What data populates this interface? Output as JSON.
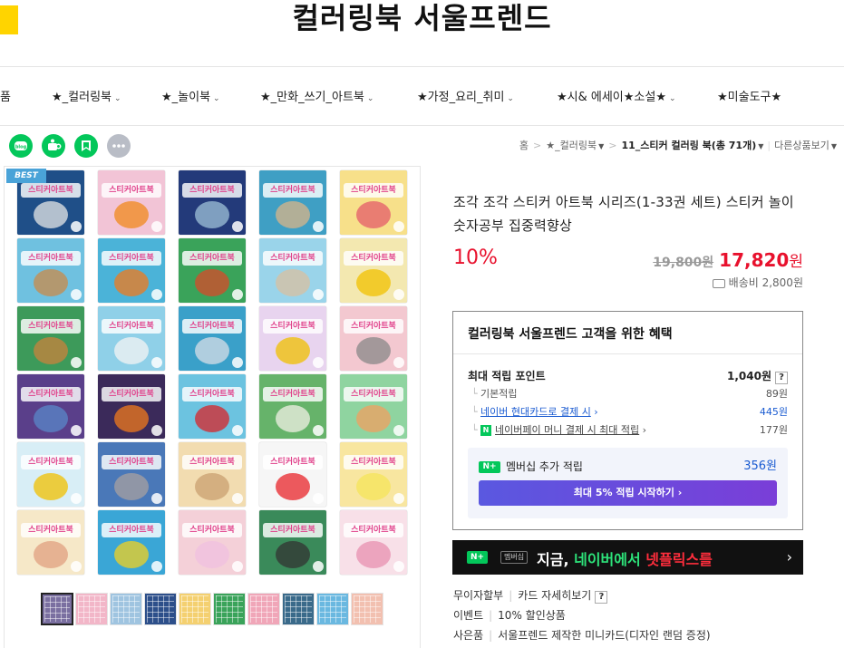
{
  "header": {
    "store_name": "컬러링북 서울프렌드"
  },
  "nav": {
    "items": [
      {
        "label": "품",
        "has_chevron": false
      },
      {
        "label": "★_컬러링북",
        "has_chevron": true
      },
      {
        "label": "★_놀이북",
        "has_chevron": true
      },
      {
        "label": "★_만화_쓰기_아트북",
        "has_chevron": true
      },
      {
        "label": "★가정_요리_취미",
        "has_chevron": true
      },
      {
        "label": "★시& 에세이★소설★",
        "has_chevron": true
      },
      {
        "label": "★미술도구★",
        "has_chevron": false
      }
    ],
    "chevron": "⌄"
  },
  "share": [
    {
      "name": "blog-icon",
      "color": "#03c75a"
    },
    {
      "name": "cafe-icon",
      "color": "#03c75a"
    },
    {
      "name": "bookmark-icon",
      "color": "#03c75a"
    },
    {
      "name": "more-icon",
      "color": "#b9bdc6"
    }
  ],
  "breadcrumb": {
    "home": "홈",
    "category": "★_컬러링북",
    "current": "11_스티커 컬러링 북",
    "count": "(총 71개)",
    "other": "다른상품보기"
  },
  "gallery": {
    "badge": "BEST",
    "book_label": "스티커아트북",
    "books": [
      {
        "bg": "#1f4f88",
        "accent": "#e6e6e6"
      },
      {
        "bg": "#f2c4d6",
        "accent": "#f08a1c"
      },
      {
        "bg": "#233a7a",
        "accent": "#9fc2d8"
      },
      {
        "bg": "#3f9fc4",
        "accent": "#d9b488"
      },
      {
        "bg": "#f7e08a",
        "accent": "#e45c6a"
      },
      {
        "bg": "#6fc1e0",
        "accent": "#c98a4a"
      },
      {
        "bg": "#4bb3d8",
        "accent": "#f07a1c"
      },
      {
        "bg": "#3aa35a",
        "accent": "#d84a2a"
      },
      {
        "bg": "#9ad4ea",
        "accent": "#d8c0a0"
      },
      {
        "bg": "#f3e8b0",
        "accent": "#f2c200"
      },
      {
        "bg": "#3d9a5a",
        "accent": "#c9813c"
      },
      {
        "bg": "#8fd0e8",
        "accent": "#f4f4f4"
      },
      {
        "bg": "#3aa0c9",
        "accent": "#d8dde6"
      },
      {
        "bg": "#e8d4ef",
        "accent": "#f0c000"
      },
      {
        "bg": "#f3c8d0",
        "accent": "#888888"
      },
      {
        "bg": "#5a3f8a",
        "accent": "#5a88c8"
      },
      {
        "bg": "#3b2a5a",
        "accent": "#f07a1c"
      },
      {
        "bg": "#6cc3e0",
        "accent": "#d8242a"
      },
      {
        "bg": "#66b36a",
        "accent": "#f2f0e6"
      },
      {
        "bg": "#8fd4a0",
        "accent": "#f0a060"
      },
      {
        "bg": "#d8eef6",
        "accent": "#f2c000"
      },
      {
        "bg": "#4a78b8",
        "accent": "#a8a0a0"
      },
      {
        "bg": "#f2dcb0",
        "accent": "#c9a070"
      },
      {
        "bg": "#f6f6f6",
        "accent": "#e8242a"
      },
      {
        "bg": "#f8e6a0",
        "accent": "#f5e45a"
      },
      {
        "bg": "#f6e8c8",
        "accent": "#e0a080"
      },
      {
        "bg": "#3aa6d6",
        "accent": "#f2d020"
      },
      {
        "bg": "#f4d0d8",
        "accent": "#f0c0e0"
      },
      {
        "bg": "#3a8a5a",
        "accent": "#333333"
      },
      {
        "bg": "#f8e0e8",
        "accent": "#e890b0"
      }
    ],
    "thumbs": [
      "#7a6fa0",
      "#f2b6c8",
      "#9fc4e0",
      "#2d4f8a",
      "#f4d070",
      "#3aa35a",
      "#f0a6b8",
      "#3a6a8a",
      "#6ab8e0",
      "#f2c0b0"
    ]
  },
  "product": {
    "title": "조각 조각 스티커 아트북 시리즈(1-33권 세트) 스티커 놀이 숫자공부 집중력향상",
    "discount": "10%",
    "original_price": "19,800원",
    "sale_price": "17,820",
    "sale_unit": "원",
    "shipping": "배송비 2,800원"
  },
  "benefit": {
    "title": "컬러링북 서울프렌드 고객을 위한 혜택",
    "max_label": "최대 적립 포인트",
    "max_value": "1,040원",
    "help": "?",
    "basic_label": "기본적립",
    "basic_value": "89원",
    "card_label": "네이버 현대카드로 결제 시",
    "card_value": "445원",
    "npay_label": "네이버페이 머니 결제 시 최대 적립",
    "npay_value": "177원",
    "npay_icon": "N",
    "member_badge": "N+",
    "member_label": "멤버십 추가 적립",
    "member_value": "356원",
    "start_button": "최대 5% 적립 시작하기 ›"
  },
  "naver_banner": {
    "n_badge": "N+",
    "m_badge": "멤버십",
    "text_1": "지금, ",
    "text_2": "네이버에서 ",
    "text_3": "넷플릭스를",
    "arrow": "›"
  },
  "extra": {
    "installment": "무이자할부",
    "card_detail": "카드 자세히보기",
    "event_label": "이벤트",
    "event_value": "10% 할인상품",
    "gift_label": "사은품",
    "gift_value": "서울프렌드 제작한 미니카드(디자인 랜덤 증정)"
  }
}
